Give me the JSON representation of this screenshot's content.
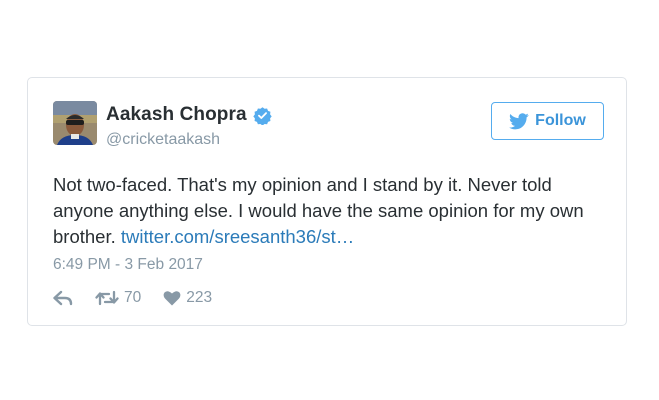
{
  "tweet": {
    "author": {
      "display_name": "Aakash Chopra",
      "handle": "@cricketaakash",
      "verified": true,
      "avatar_icon": "profile-photo"
    },
    "follow_button": {
      "label": "Follow",
      "icon": "twitter-bird-icon"
    },
    "text_main": "Not two-faced. That's my opinion and I stand by it. Never told anyone anything else. I would have the same opinion for my own brother.",
    "link_text": "twitter.com/sreesanth36/st…",
    "timestamp": "6:49 PM - 3 Feb 2017",
    "actions": {
      "reply_icon": "reply-icon",
      "retweet_icon": "retweet-icon",
      "retweet_count": "70",
      "like_icon": "heart-icon",
      "like_count": "223"
    },
    "colors": {
      "accent": "#55acee",
      "link": "#2b7bb9",
      "text": "#292f33",
      "muted": "#8899a6"
    }
  }
}
